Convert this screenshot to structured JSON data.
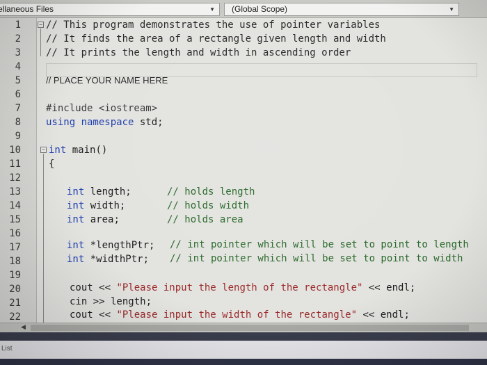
{
  "navbar": {
    "project_combo": "ellaneous Files",
    "scope_combo": "(Global Scope)"
  },
  "gutter": {
    "line_numbers": [
      "1",
      "2",
      "3",
      "4",
      "5",
      "6",
      "7",
      "8",
      "9",
      "10",
      "11",
      "12",
      "13",
      "14",
      "15",
      "16",
      "17",
      "18",
      "19",
      "20",
      "21",
      "22"
    ]
  },
  "code": {
    "l1": "// This program demonstrates the use of pointer variables",
    "l2": "// It finds the area of a rectangle given length and width",
    "l3": "// It prints the length and width in ascending order",
    "l5": "// PLACE YOUR NAME HERE",
    "l7": "#include <iostream>",
    "l8_kw": "using namespace",
    "l8_rest": " std;",
    "l10_kw": "int",
    "l10_rest": " main()",
    "l11": "{",
    "l13_kw": "int",
    "l13_rest": " length;",
    "l13_cm": "// holds length",
    "l14_kw": "int",
    "l14_rest": " width;",
    "l14_cm": "// holds width",
    "l15_kw": "int",
    "l15_rest": " area;",
    "l15_cm": "// holds area",
    "l17_kw": "int",
    "l17_rest": " *lengthPtr;",
    "l17_cm": "// int pointer which will be set to point to length",
    "l18_kw": "int",
    "l18_rest": " *widthPtr;",
    "l18_cm": "// int pointer which will be set to point to width",
    "l20_a": "cout << ",
    "l20_str": "\"Please input the length of the rectangle\"",
    "l20_b": " << endl;",
    "l21": "cin >> length;",
    "l22_a": "cout << ",
    "l22_str": "\"Please input the width of the rectangle\"",
    "l22_b": " << endl;"
  },
  "bottom_panel": {
    "tab_label": "List"
  },
  "colors": {
    "comment": "#2a6a2a",
    "keyword": "#1f3fae",
    "string": "#9a2a2a",
    "editor_bg": "#e3e3e0",
    "panel_dark": "#3a3d4c"
  }
}
